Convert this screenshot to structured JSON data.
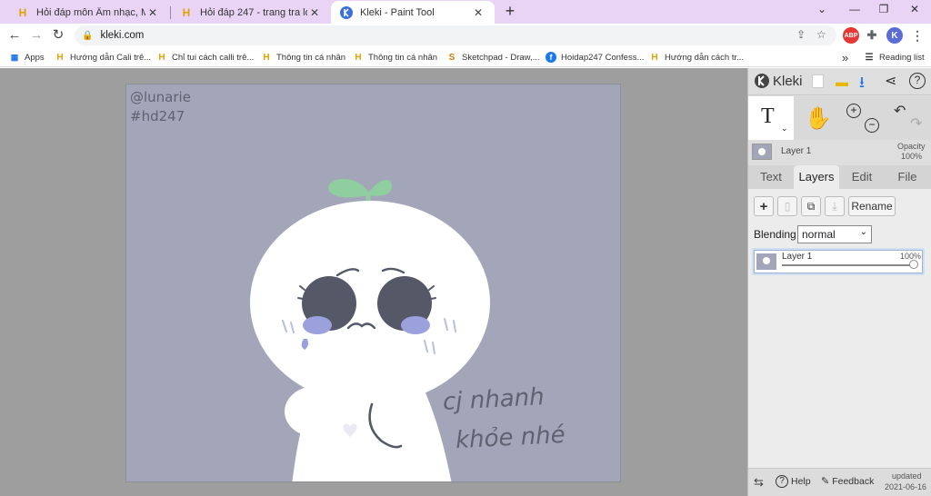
{
  "tabs": [
    {
      "title": "Hỏi đáp môn Âm nhạc, Mỹ thuật",
      "close": "✕"
    },
    {
      "title": "Hỏi đáp 247 - trang tra loi",
      "close": "✕"
    },
    {
      "title": "Kleki - Paint Tool",
      "close": "✕"
    }
  ],
  "browser": {
    "new_tab": "+",
    "url": "kleki.com",
    "reading_list": "Reading list",
    "more_bookmarks": "»",
    "profile_initial": "K",
    "adblock": "ABP"
  },
  "bookmarks": [
    {
      "label": "Apps"
    },
    {
      "label": "Hướng dẫn Cali trê..."
    },
    {
      "label": "Chỉ tui cách calli trê..."
    },
    {
      "label": "Thông tin cá nhân"
    },
    {
      "label": "Thông tin cá nhân"
    },
    {
      "label": "Sketchpad - Draw,..."
    },
    {
      "label": "Hoidap247 Confess..."
    },
    {
      "label": "Hướng dẫn cách tr..."
    }
  ],
  "canvas": {
    "watermark_line1": "@lunarie",
    "watermark_line2": "#hd247",
    "caption_line1": "cj nhanh",
    "caption_line2": "khỏe nhé"
  },
  "panel": {
    "logo": "Kleki",
    "layer_name": "Layer 1",
    "opacity_label": "Opacity",
    "opacity_value": "100%",
    "tabs": [
      "Text",
      "Layers",
      "Edit",
      "File"
    ],
    "active_tab": "Layers",
    "rename": "Rename",
    "blending_label": "Blending",
    "blending_value": "normal",
    "layer_item_name": "Layer 1",
    "layer_item_opacity": "100%",
    "layer_item_opacity_level": 1.0,
    "text_tool_glyph": "T",
    "help": "Help",
    "feedback": "Feedback",
    "updated_label": "updated",
    "updated_date": "2021-06-16"
  },
  "colors": {
    "canvas_bg": "#a3a6b8",
    "tab_strip": "#e9d4f5",
    "sprout": "#8fce9e",
    "eye": "#555866",
    "tear": "#9aa1dd"
  }
}
